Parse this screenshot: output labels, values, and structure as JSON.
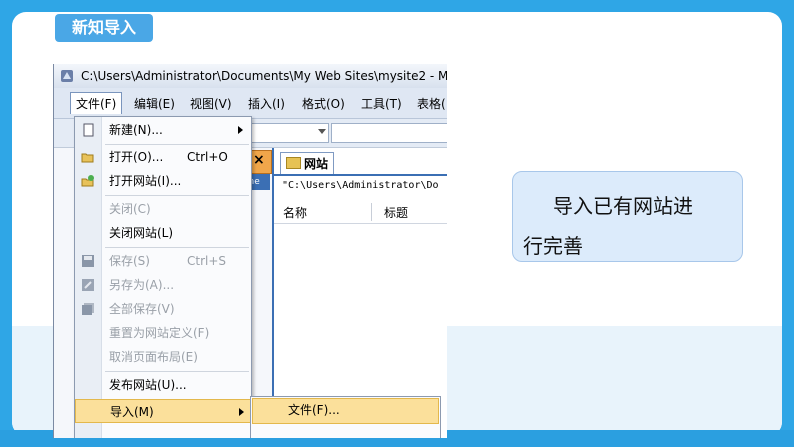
{
  "slide": {
    "tag_label": "新知导入",
    "callout_line1": "导入已有网站进",
    "callout_line2": "行完善"
  },
  "window": {
    "title": "C:\\Users\\Administrator\\Documents\\My Web Sites\\mysite2 - M",
    "menubar": [
      {
        "label": "文件(F)"
      },
      {
        "label": "编辑(E)"
      },
      {
        "label": "视图(V)"
      },
      {
        "label": "插入(I)"
      },
      {
        "label": "格式(O)"
      },
      {
        "label": "工具(T)"
      },
      {
        "label": "表格("
      }
    ]
  },
  "file_menu": {
    "items": [
      {
        "label": "新建(N)...",
        "shortcut": "",
        "enabled": true,
        "submenu": true,
        "icon": "new-page-icon"
      },
      {
        "label": "打开(O)...",
        "shortcut": "Ctrl+O",
        "enabled": true,
        "submenu": false,
        "icon": "open-folder-icon"
      },
      {
        "label": "打开网站(I)...",
        "shortcut": "",
        "enabled": true,
        "submenu": false,
        "icon": "open-site-icon"
      },
      {
        "label": "关闭(C)",
        "shortcut": "",
        "enabled": false,
        "submenu": false,
        "icon": ""
      },
      {
        "label": "关闭网站(L)",
        "shortcut": "",
        "enabled": true,
        "submenu": false,
        "icon": ""
      },
      {
        "label": "保存(S)",
        "shortcut": "Ctrl+S",
        "enabled": false,
        "submenu": false,
        "icon": "save-icon"
      },
      {
        "label": "另存为(A)...",
        "shortcut": "",
        "enabled": false,
        "submenu": false,
        "icon": "save-as-icon"
      },
      {
        "label": "全部保存(V)",
        "shortcut": "",
        "enabled": false,
        "submenu": false,
        "icon": "save-all-icon"
      },
      {
        "label": "重置为网站定义(F)",
        "shortcut": "",
        "enabled": false,
        "submenu": false,
        "icon": ""
      },
      {
        "label": "取消页面布局(E)",
        "shortcut": "",
        "enabled": false,
        "submenu": false,
        "icon": ""
      },
      {
        "label": "发布网站(U)...",
        "shortcut": "",
        "enabled": true,
        "submenu": false,
        "icon": ""
      },
      {
        "label": "导入(M)",
        "shortcut": "",
        "enabled": true,
        "submenu": true,
        "icon": "",
        "highlighted": true
      }
    ]
  },
  "import_submenu": {
    "items": [
      {
        "label": "文件(F)..."
      }
    ]
  },
  "site_panel": {
    "tab_label": "网站",
    "path": "\"C:\\Users\\Administrator\\Do",
    "columns": [
      "名称",
      "标题"
    ],
    "close_glyph": "×",
    "strip_text": "ine"
  },
  "colors": {
    "highlight": "#fbe09b",
    "panel_blue": "#3b6fb4",
    "callout_bg": "#dcebfb",
    "tag_bg": "#4aa7e6"
  }
}
